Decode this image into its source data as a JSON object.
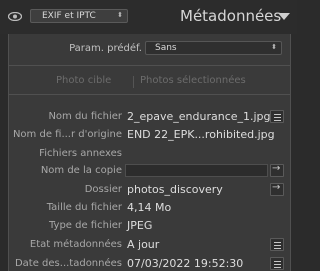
{
  "header": {
    "preset_label": "EXIF et IPTC",
    "title": "Métadonnées"
  },
  "defaults": {
    "label": "Param. prédéf.",
    "value": "Sans"
  },
  "tabs": {
    "target_photo": "Photo cible",
    "selected_photos": "Photos sélectionnées"
  },
  "fields": {
    "file_name": {
      "label": "Nom du fichier",
      "value": "2_epave_endurance_1.jpg"
    },
    "original_name": {
      "label": "Nom de fi...r d'origine",
      "value": "END 22_EPK...rohibited.jpg"
    },
    "sidecars": {
      "label": "Fichiers annexes"
    },
    "copy_name": {
      "label": "Nom de la copie",
      "value": ""
    },
    "folder": {
      "label": "Dossier",
      "value": "photos_discovery"
    },
    "file_size": {
      "label": "Taille du fichier",
      "value": "4,14 Mo"
    },
    "file_type": {
      "label": "Type de fichier",
      "value": "JPEG"
    },
    "metadata_status": {
      "label": "Etat métadonnées",
      "value": "A jour"
    },
    "capture_date": {
      "label": "Date des...tadonnées",
      "value": "07/03/2022 19:52:30"
    }
  },
  "icons": {
    "visibility": "eye-icon",
    "collapse": "triangle-down-icon",
    "list": "list-icon",
    "go_to": "arrow-right-icon"
  }
}
